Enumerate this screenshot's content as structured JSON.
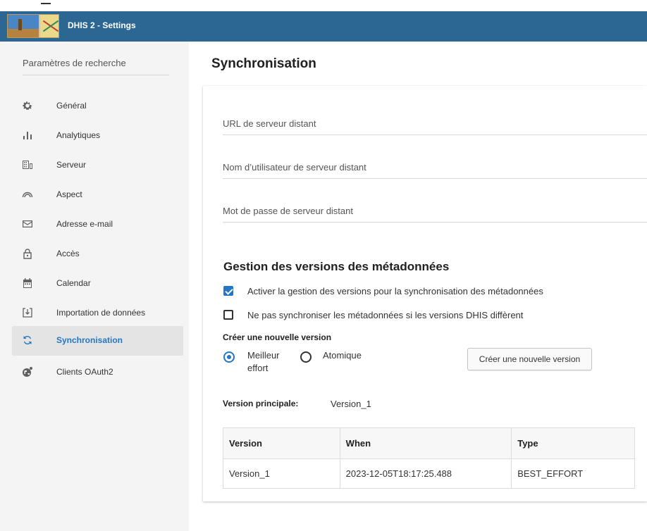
{
  "header": {
    "title": "DHIS 2 - Settings"
  },
  "sidebar": {
    "search_placeholder": "Paramètres de recherche",
    "items": [
      {
        "label": "Général",
        "icon": "gear-icon",
        "active": false
      },
      {
        "label": "Analytiques",
        "icon": "bar-chart-icon",
        "active": false
      },
      {
        "label": "Serveur",
        "icon": "server-icon",
        "active": false
      },
      {
        "label": "Aspect",
        "icon": "rainbow-icon",
        "active": false
      },
      {
        "label": "Adresse e-mail",
        "icon": "mail-icon",
        "active": false
      },
      {
        "label": "Accès",
        "icon": "lock-icon",
        "active": false
      },
      {
        "label": "Calendar",
        "icon": "calendar-icon",
        "active": false
      },
      {
        "label": "Importation de données",
        "icon": "import-icon",
        "active": false
      },
      {
        "label": "Synchronisation",
        "icon": "sync-icon",
        "active": true
      },
      {
        "label": "Clients OAuth2",
        "icon": "oauth-globe-icon",
        "active": false
      }
    ]
  },
  "main": {
    "title": "Synchronisation",
    "fields": {
      "remote_url": "URL de serveur distant",
      "remote_user": "Nom d’utilisateur de serveur distant",
      "remote_password": "Mot de passe de serveur distant"
    },
    "metadata_section": {
      "title": "Gestion des versions des métadonnées",
      "enable_versioning": {
        "label": "Activer la gestion des versions pour la synchronisation des métadonnées",
        "checked": true
      },
      "dont_sync_if_differ": {
        "label": "Ne pas synchroniser les métadonnées si les versions DHIS diffèrent",
        "checked": false
      },
      "create_version_title": "Créer une nouvelle version",
      "radio_best_effort_line1": "Meilleur",
      "radio_best_effort_line2": "effort",
      "radio_atomic": "Atomique",
      "selected_type": "best_effort",
      "create_button": "Créer une nouvelle version",
      "master_version_label": "Version principale:",
      "master_version_value": "Version_1",
      "table": {
        "headers": [
          "Version",
          "When",
          "Type"
        ],
        "rows": [
          [
            "Version_1",
            "2023-12-05T18:17:25.488",
            "BEST_EFFORT"
          ]
        ]
      }
    }
  },
  "colors": {
    "header_bg": "#2c6693",
    "accent": "#2477c6",
    "sidebar_bg": "#f4f4f4",
    "active_item_bg": "#e4e4e4"
  }
}
